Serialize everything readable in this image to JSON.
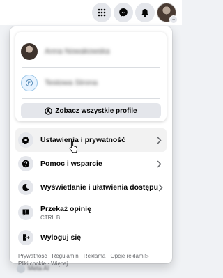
{
  "topbar": {
    "icons": [
      "menu-grid-icon",
      "messenger-icon",
      "notifications-bell-icon",
      "account-avatar"
    ]
  },
  "profiles": {
    "items": [
      {
        "name": "Anna Nowakowska",
        "type": "personal"
      },
      {
        "name": "Testowa Strona",
        "type": "page"
      }
    ],
    "see_all_label": "Zobacz wszystkie profile"
  },
  "menu": {
    "settings_label": "Ustawienia i prywatność",
    "help_label": "Pomoc i wsparcie",
    "display_label": "Wyświetlanie i ułatwienia dostępu",
    "feedback_label": "Przekaż opinię",
    "feedback_shortcut": "CTRL B",
    "logout_label": "Wyloguj się"
  },
  "footer": {
    "links": [
      "Prywatność",
      "Regulamin",
      "Reklama",
      "Opcje reklam",
      "Pliki cookie",
      "Więcej"
    ],
    "line1": "Prywatność · Regulamin · Reklama · Opcje reklam ▷ ·",
    "line2": "Pliki cookie · Więcej"
  },
  "background_peek": {
    "text": "Meta AI"
  },
  "colors": {
    "page_bg": "#f0f2f5",
    "panel_bg": "#ffffff",
    "icon_bg": "#e4e6eb",
    "text_primary": "#050505",
    "text_secondary": "#65676b"
  }
}
